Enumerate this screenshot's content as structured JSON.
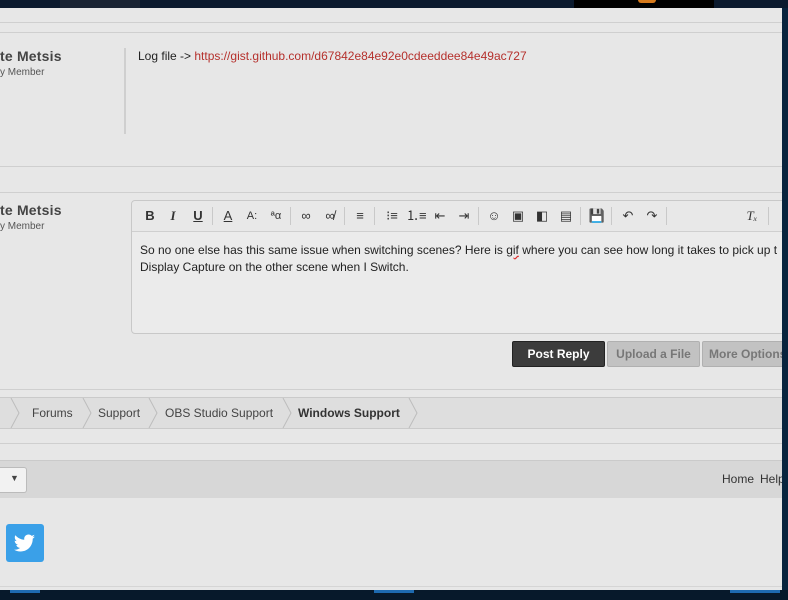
{
  "posts": [
    {
      "author": "te Metsis",
      "role": "y Member",
      "message_prefix": "Log file -> ",
      "message_link": "https://gist.github.com/d67842e84e92e0cdeeddee84e49ac727"
    }
  ],
  "reply": {
    "author": "te Metsis",
    "role": "y Member",
    "text_line1_a": "So no one else has this same issue when switching scenes? Here is ",
    "text_line1_spell": "gif",
    "text_line1_b": " where you can see how long it takes to pick up t",
    "text_line2": "Display Capture on the other scene when I Switch.",
    "toolbar": [
      "bold-icon",
      "italic-icon",
      "underline-icon",
      "font-color-icon",
      "font-size-icon",
      "font-family-icon",
      "link-icon",
      "unlink-icon",
      "align-icon",
      "bullet-list-icon",
      "number-list-icon",
      "outdent-icon",
      "indent-icon",
      "smilie-icon",
      "image-icon",
      "media-icon",
      "code-icon",
      "save-draft-icon",
      "undo-icon",
      "redo-icon",
      "remove-format-icon"
    ]
  },
  "buttons": {
    "post_reply": "Post Reply",
    "upload_file": "Upload a File",
    "more_options": "More Options"
  },
  "breadcrumb": [
    "Forums",
    "Support",
    "OBS Studio Support",
    "Windows Support"
  ],
  "footer": {
    "home": "Home",
    "help": "Help"
  },
  "colors": {
    "link": "#b5302c",
    "primary_button": "#3c3c3c",
    "twitter": "#3aa0e8"
  }
}
